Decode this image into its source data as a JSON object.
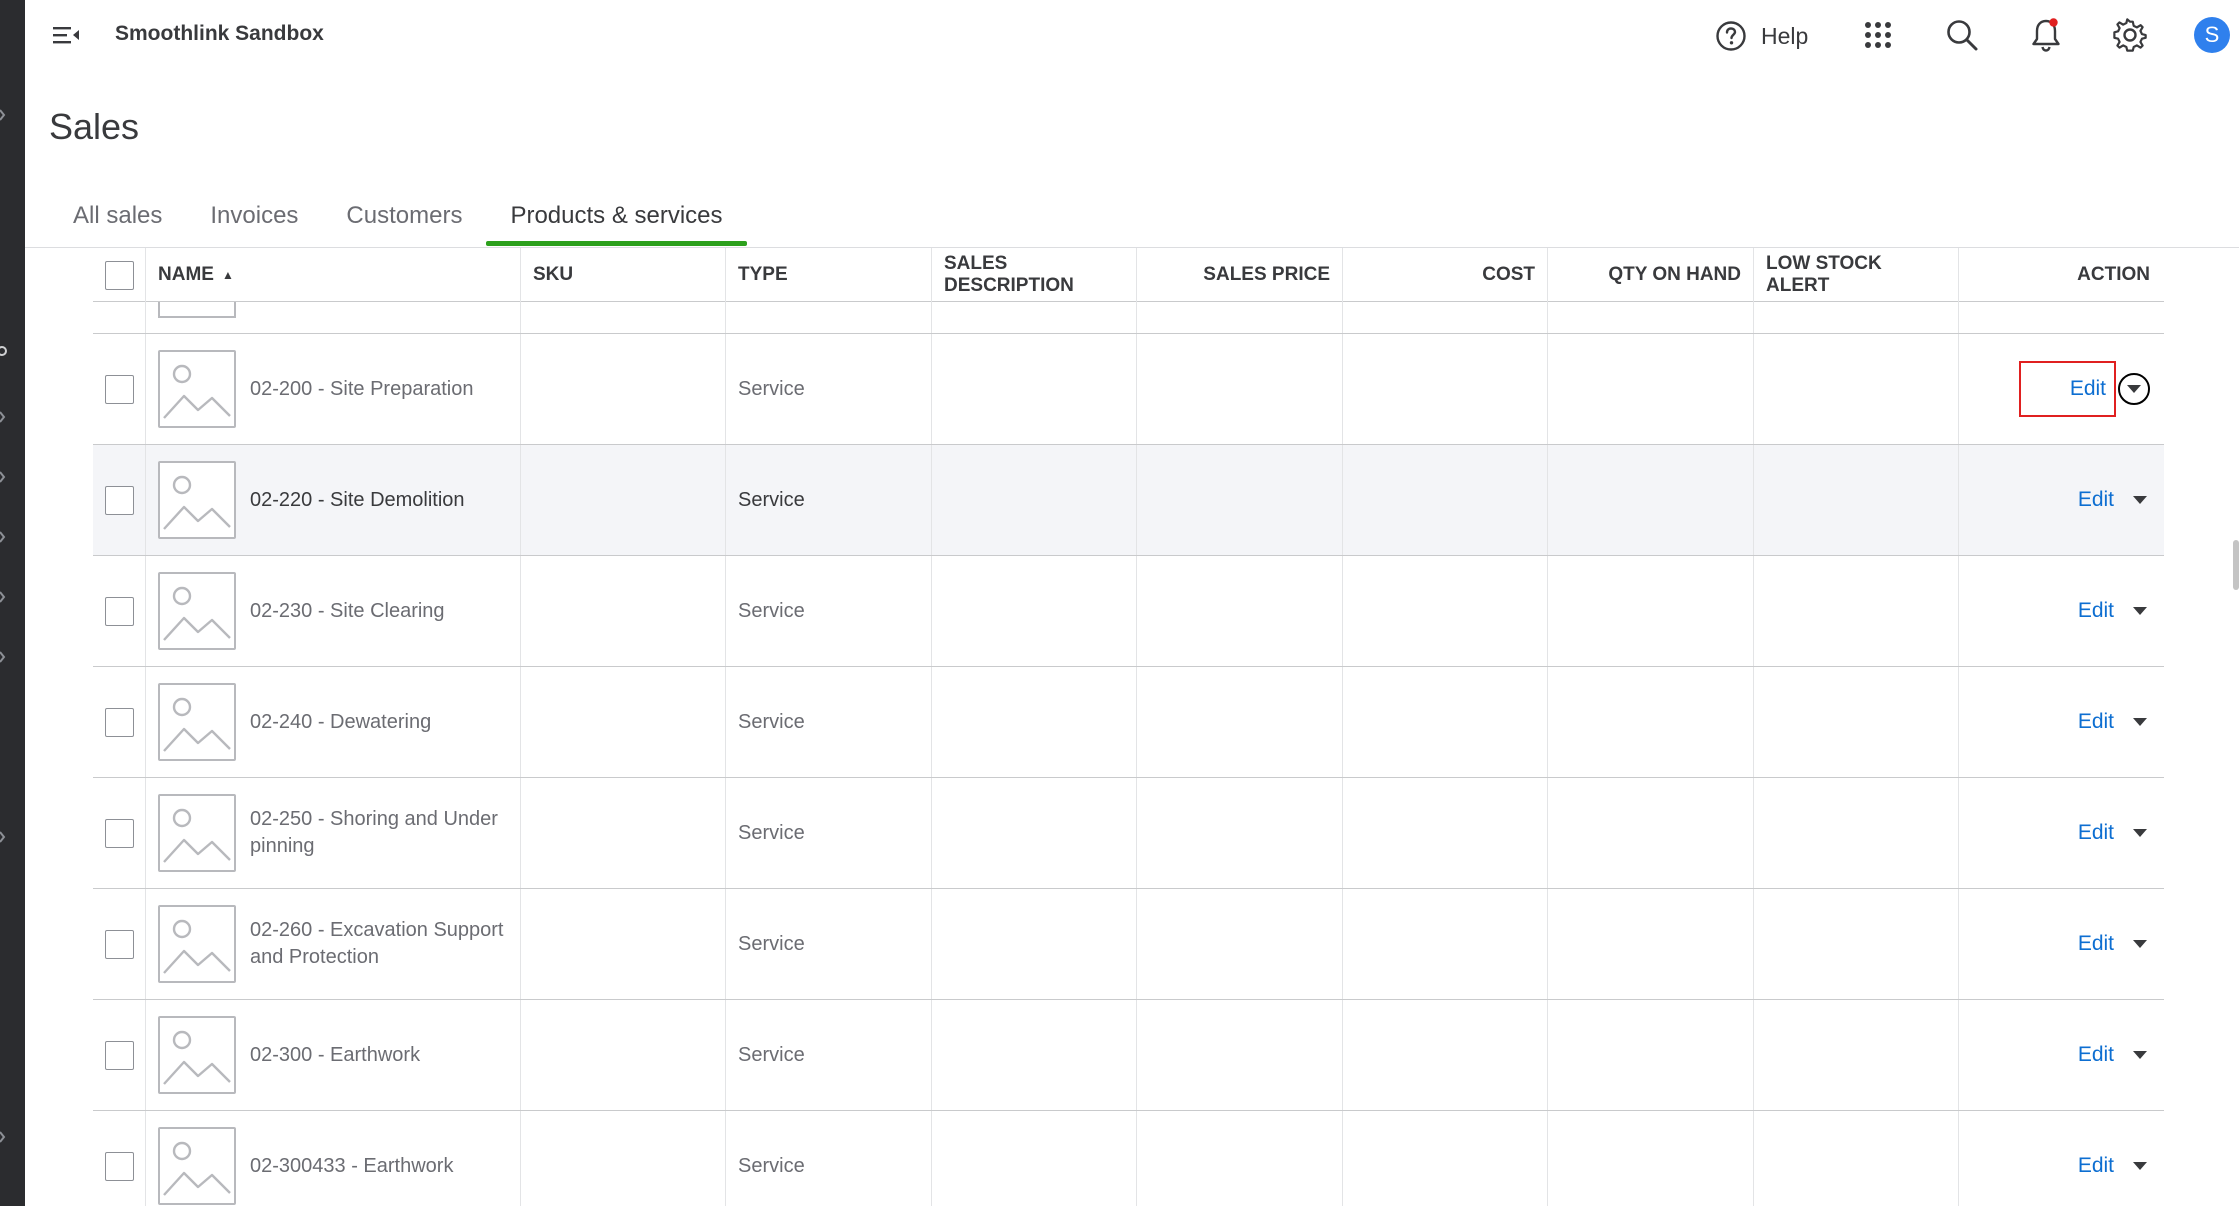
{
  "header": {
    "company_name": "Smoothlink Sandbox",
    "help_label": "Help",
    "avatar_initial": "S"
  },
  "page": {
    "title": "Sales"
  },
  "tabs": [
    {
      "label": "All sales"
    },
    {
      "label": "Invoices"
    },
    {
      "label": "Customers"
    },
    {
      "label": "Products & services",
      "active": true
    }
  ],
  "table": {
    "columns": {
      "name": "NAME",
      "sku": "SKU",
      "type": "TYPE",
      "sales_description": "SALES DESCRIPTION",
      "sales_price": "SALES PRICE",
      "cost": "COST",
      "qty_on_hand": "QTY ON HAND",
      "low_stock_alert": "LOW STOCK ALERT",
      "action": "ACTION"
    },
    "action_label": "Edit",
    "rows": [
      {
        "name": "02-200 - Site Preparation",
        "type": "Service"
      },
      {
        "name": "02-220 - Site Demolition",
        "type": "Service"
      },
      {
        "name": "02-230 - Site Clearing",
        "type": "Service"
      },
      {
        "name": "02-240 - Dewatering",
        "type": "Service"
      },
      {
        "name_line1": "02-250 - Shoring and Under",
        "name_line2": "pinning",
        "type": "Service"
      },
      {
        "name_line1": "02-260 - Excavation Support",
        "name_line2": "and Protection",
        "type": "Service"
      },
      {
        "name": "02-300 - Earthwork",
        "type": "Service"
      },
      {
        "name": "02-300433 - Earthwork",
        "type": "Service"
      }
    ]
  },
  "colors": {
    "tab_active_underline": "#2ca01c",
    "link": "#0d6ed1",
    "highlight_box": "#e02020",
    "avatar": "#2f80ed",
    "notification_dot": "#e02020"
  }
}
